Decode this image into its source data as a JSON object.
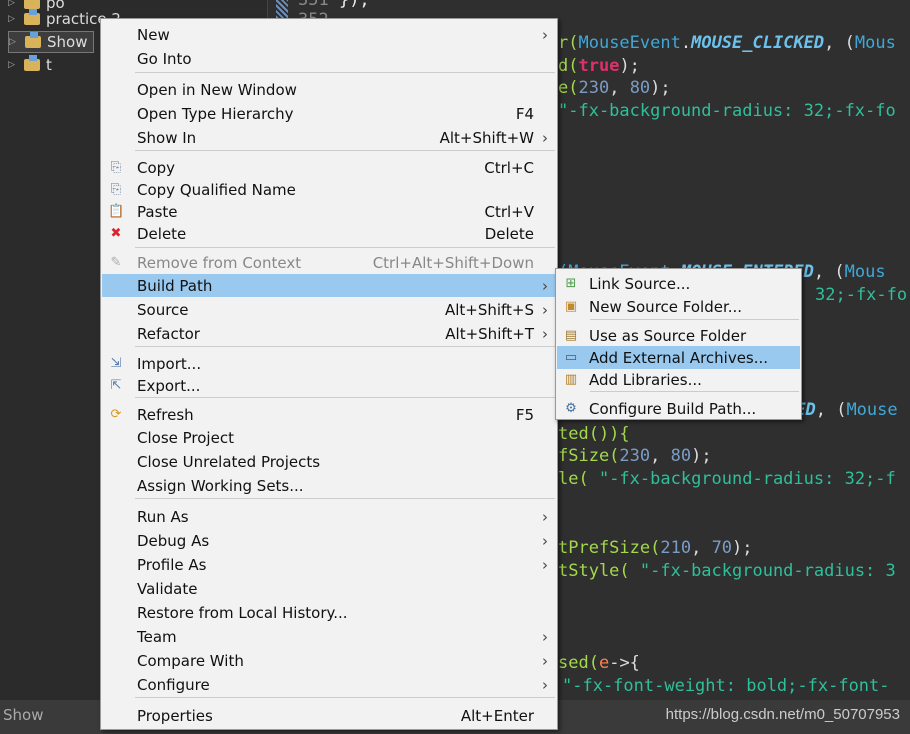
{
  "explorer": {
    "items": [
      {
        "label": "po"
      },
      {
        "label": "practice 2"
      },
      {
        "label": "Show",
        "selected": true
      },
      {
        "label": "t"
      }
    ]
  },
  "editor": {
    "line_numbers": [
      "351",
      "352"
    ],
    "top_line": " });"
  },
  "context_menu": {
    "items": [
      {
        "label": "New",
        "submenu": true
      },
      {
        "label": "Go Into"
      },
      {
        "label": "Open in New Window"
      },
      {
        "label": "Open Type Hierarchy",
        "shortcut": "F4"
      },
      {
        "label": "Show In",
        "shortcut": "Alt+Shift+W",
        "submenu": true
      },
      {
        "label": "Copy",
        "shortcut": "Ctrl+C",
        "icon": "copy-icon"
      },
      {
        "label": "Copy Qualified Name",
        "icon": "copy-qualified-icon"
      },
      {
        "label": "Paste",
        "shortcut": "Ctrl+V",
        "icon": "paste-icon"
      },
      {
        "label": "Delete",
        "shortcut": "Delete",
        "icon": "delete-icon"
      },
      {
        "label": "Remove from Context",
        "shortcut": "Ctrl+Alt+Shift+Down",
        "disabled": true,
        "icon": "remove-context-icon"
      },
      {
        "label": "Build Path",
        "submenu": true,
        "highlighted": true
      },
      {
        "label": "Source",
        "shortcut": "Alt+Shift+S",
        "submenu": true
      },
      {
        "label": "Refactor",
        "shortcut": "Alt+Shift+T",
        "submenu": true
      },
      {
        "label": "Import...",
        "icon": "import-icon"
      },
      {
        "label": "Export...",
        "icon": "export-icon"
      },
      {
        "label": "Refresh",
        "shortcut": "F5",
        "icon": "refresh-icon"
      },
      {
        "label": "Close Project"
      },
      {
        "label": "Close Unrelated Projects"
      },
      {
        "label": "Assign Working Sets..."
      },
      {
        "label": "Run As",
        "submenu": true
      },
      {
        "label": "Debug As",
        "submenu": true
      },
      {
        "label": "Profile As",
        "submenu": true
      },
      {
        "label": "Validate"
      },
      {
        "label": "Restore from Local History..."
      },
      {
        "label": "Team",
        "submenu": true
      },
      {
        "label": "Compare With",
        "submenu": true
      },
      {
        "label": "Configure",
        "submenu": true
      },
      {
        "label": "Properties",
        "shortcut": "Alt+Enter"
      }
    ]
  },
  "build_path_submenu": {
    "items": [
      {
        "label": "Link Source...",
        "icon": "link-source-icon"
      },
      {
        "label": "New Source Folder...",
        "icon": "new-source-folder-icon"
      },
      {
        "label": "Use as Source Folder",
        "icon": "source-folder-icon"
      },
      {
        "label": "Add External Archives...",
        "icon": "archive-icon",
        "highlighted": true
      },
      {
        "label": "Add Libraries...",
        "icon": "library-icon"
      },
      {
        "label": "Configure Build Path...",
        "icon": "configure-icon"
      }
    ]
  },
  "code": [
    [
      "r(",
      "MouseEvent",
      ".",
      "MOUSE_CLICKED",
      ", (",
      "Mous"
    ],
    [
      "d(",
      "true",
      ");"
    ],
    [
      "e(",
      "230",
      ", ",
      "80",
      ");"
    ],
    [
      "\"-fx-background-radius: 32;-fx-fo"
    ],
    [
      "(MouseEvent.",
      "MOUSE_ENTERED",
      ", (",
      "Mous"
    ],
    [
      "32;-fx-fo"
    ],
    [
      "TED",
      ", (",
      "Mouse"
    ],
    [
      "ted()){"
    ],
    [
      "fSize(",
      "230",
      ", ",
      "80",
      ");"
    ],
    [
      "le( ",
      "\"-fx-background-radius: 32;-f"
    ],
    [
      "tPrefSize(",
      "210",
      ", ",
      "70",
      ");"
    ],
    [
      "tStyle( ",
      "\"-fx-background-radius: 3"
    ],
    [
      "sed(",
      "e",
      "->{"
    ],
    [
      "\"-fx-font-weight: bold;-fx-font-"
    ]
  ],
  "status": {
    "left": "Show",
    "watermark": "https://blog.csdn.net/m0_50707953"
  },
  "colors": {
    "highlight": "#99c9ef",
    "menu_bg": "#f2f2f2",
    "editor_bg": "#2f2f2f"
  }
}
